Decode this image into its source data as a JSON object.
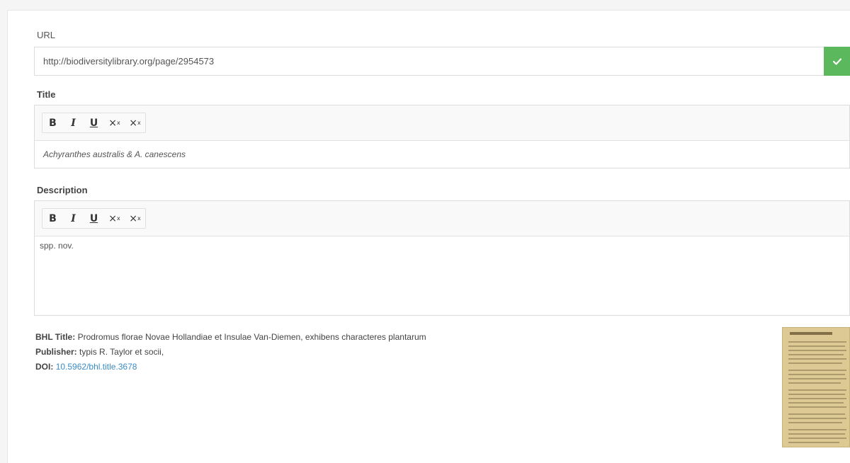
{
  "url_field": {
    "label": "URL",
    "value": "http://biodiversitylibrary.org/page/2954573",
    "confirm_icon": "check-icon"
  },
  "toolbar_buttons": {
    "bold": "B",
    "italic": "I",
    "underline": "U",
    "subscript": "×",
    "superscript": "×"
  },
  "title_field": {
    "label": "Title",
    "value": "Achyranthes australis & A. canescens"
  },
  "description_field": {
    "label": "Description",
    "value": "spp. nov."
  },
  "metadata": {
    "bhl_title_key": "BHL Title:",
    "bhl_title_value": "Prodromus florae Novae Hollandiae et Insulae Van-Diemen, exhibens characteres plantarum",
    "publisher_key": "Publisher:",
    "publisher_value": "typis R. Taylor et socii,",
    "doi_key": "DOI:",
    "doi_value": "10.5962/bhl.title.3678"
  },
  "colors": {
    "confirm_green": "#5cb85c",
    "link_blue": "#3a8cc6"
  }
}
